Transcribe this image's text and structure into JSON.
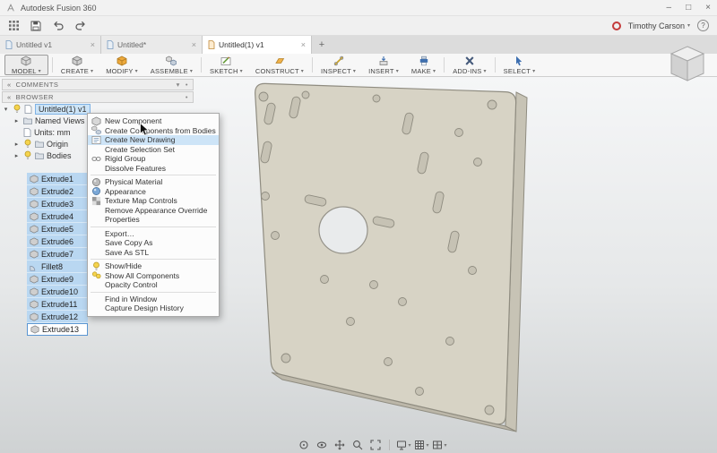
{
  "titlebar": {
    "title": "Autodesk Fusion 360"
  },
  "quickbar": {
    "user": "Timothy Carson"
  },
  "glyphs": {
    "minimize": "–",
    "maximize": "□",
    "close": "×",
    "help": "?",
    "plus": "+",
    "caret_down": "▾",
    "expander_open": "▾",
    "expander_closed": "▸",
    "chevrons_left": "«",
    "dot": "•"
  },
  "tabs": {
    "items": [
      {
        "label": "Untitled v1"
      },
      {
        "label": "Untitled*"
      },
      {
        "label": "Untitled(1) v1"
      }
    ]
  },
  "ribbon": {
    "items": [
      {
        "label": "MODEL"
      },
      {
        "label": "CREATE"
      },
      {
        "label": "MODIFY"
      },
      {
        "label": "ASSEMBLE"
      },
      {
        "label": "SKETCH"
      },
      {
        "label": "CONSTRUCT"
      },
      {
        "label": "INSPECT"
      },
      {
        "label": "INSERT"
      },
      {
        "label": "MAKE"
      },
      {
        "label": "ADD-INS"
      },
      {
        "label": "SELECT"
      }
    ]
  },
  "panels": {
    "comments": {
      "title": "COMMENTS"
    },
    "browser": {
      "title": "BROWSER"
    }
  },
  "tree": {
    "items": [
      {
        "label": "Untitled(1) v1"
      },
      {
        "label": "Named Views"
      },
      {
        "label": "Units: mm"
      },
      {
        "label": "Origin"
      },
      {
        "label": "Bodies"
      }
    ]
  },
  "features": {
    "items": [
      "Extrude1",
      "Extrude2",
      "Extrude3",
      "Extrude4",
      "Extrude5",
      "Extrude6",
      "Extrude7",
      "Fillet8",
      "Extrude9",
      "Extrude10",
      "Extrude11",
      "Extrude12",
      "Extrude13"
    ]
  },
  "context_menu": {
    "items": [
      {
        "label": "New Component"
      },
      {
        "label": "Create Components from Bodies"
      },
      {
        "label": "Create New Drawing"
      },
      {
        "label": "Create Selection Set"
      },
      {
        "label": "Rigid Group"
      },
      {
        "label": "Dissolve Features"
      },
      {
        "label": "Physical Material"
      },
      {
        "label": "Appearance"
      },
      {
        "label": "Texture Map Controls"
      },
      {
        "label": "Remove Appearance Override"
      },
      {
        "label": "Properties"
      },
      {
        "label": "Export…"
      },
      {
        "label": "Save Copy As"
      },
      {
        "label": "Save As STL"
      },
      {
        "label": "Show/Hide"
      },
      {
        "label": "Show All Components"
      },
      {
        "label": "Opacity Control"
      },
      {
        "label": "Find in Window"
      },
      {
        "label": "Capture Design History"
      }
    ]
  },
  "colors": {
    "selection_blue": "#b9d7f1",
    "highlight_border": "#5a96d2",
    "record_red": "#c43b3b",
    "plate_face": "#d7d3c5"
  }
}
